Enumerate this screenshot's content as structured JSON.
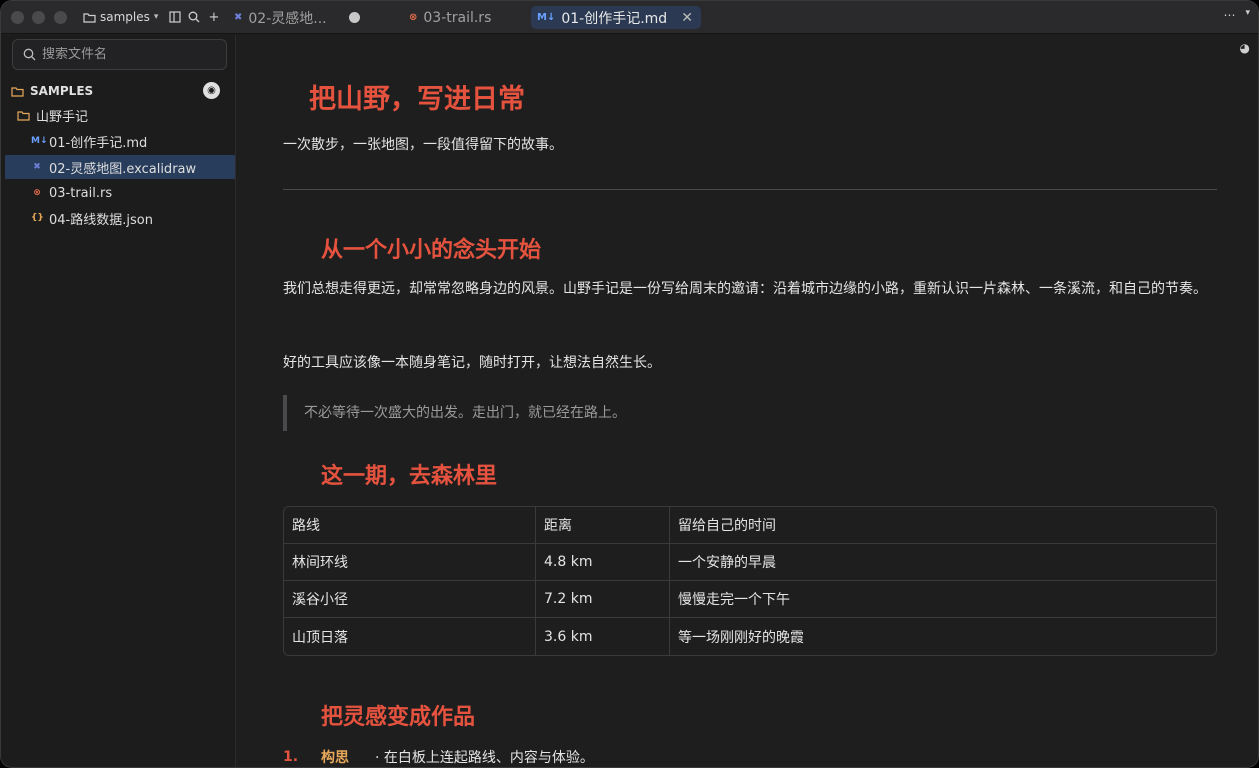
{
  "titlebar": {
    "folder": "samples",
    "tabs": [
      {
        "icon": "excalidraw-icon",
        "label": "02-灵感地..."
      },
      {
        "icon": "rust-icon",
        "label": "03-trail.rs"
      },
      {
        "icon": "markdown-icon",
        "label": "01-创作手记.md"
      }
    ]
  },
  "sidebar": {
    "search_placeholder": "搜索文件名",
    "section": "SAMPLES",
    "folder": "山野手记",
    "files": [
      {
        "icon": "markdown-icon",
        "label": "01-创作手记.md"
      },
      {
        "icon": "excalidraw-icon",
        "label": "02-灵感地图.excalidraw"
      },
      {
        "icon": "rust-icon",
        "label": "03-trail.rs"
      },
      {
        "icon": "json-icon",
        "label": "04-路线数据.json"
      }
    ]
  },
  "doc": {
    "title": "把山野，写进日常",
    "intro": "一次散步，一张地图，一段值得留下的故事。",
    "h2_1": "从一个小小的念头开始",
    "para1": "我们总想走得更远，却常常忽略身边的风景。山野手记是一份写给周末的邀请：沿着城市边缘的小路，重新认识一片森林、一条溪流，和自己的节奏。",
    "para2": "好的工具应该像一本随身笔记，随时打开，让想法自然生长。",
    "quote": "不必等待一次盛大的出发。走出门，就已经在路上。",
    "h2_2": "这一期，去森林里",
    "table": {
      "headers": [
        "路线",
        "距离",
        "留给自己的时间"
      ],
      "rows": [
        [
          "林间环线",
          "4.8 km",
          "一个安静的早晨"
        ],
        [
          "溪谷小径",
          "7.2 km",
          "慢慢走完一个下午"
        ],
        [
          "山顶日落",
          "3.6 km",
          "等一场刚刚好的晚霞"
        ]
      ]
    },
    "h2_3": "把灵感变成作品",
    "list": [
      {
        "num": "1.",
        "term": "构思",
        "text": "· 在白板上连起路线、内容与体验。"
      }
    ]
  },
  "colors": {
    "accent": "#e5533f",
    "selection": "#283d5c",
    "term": "#e8a85a"
  }
}
